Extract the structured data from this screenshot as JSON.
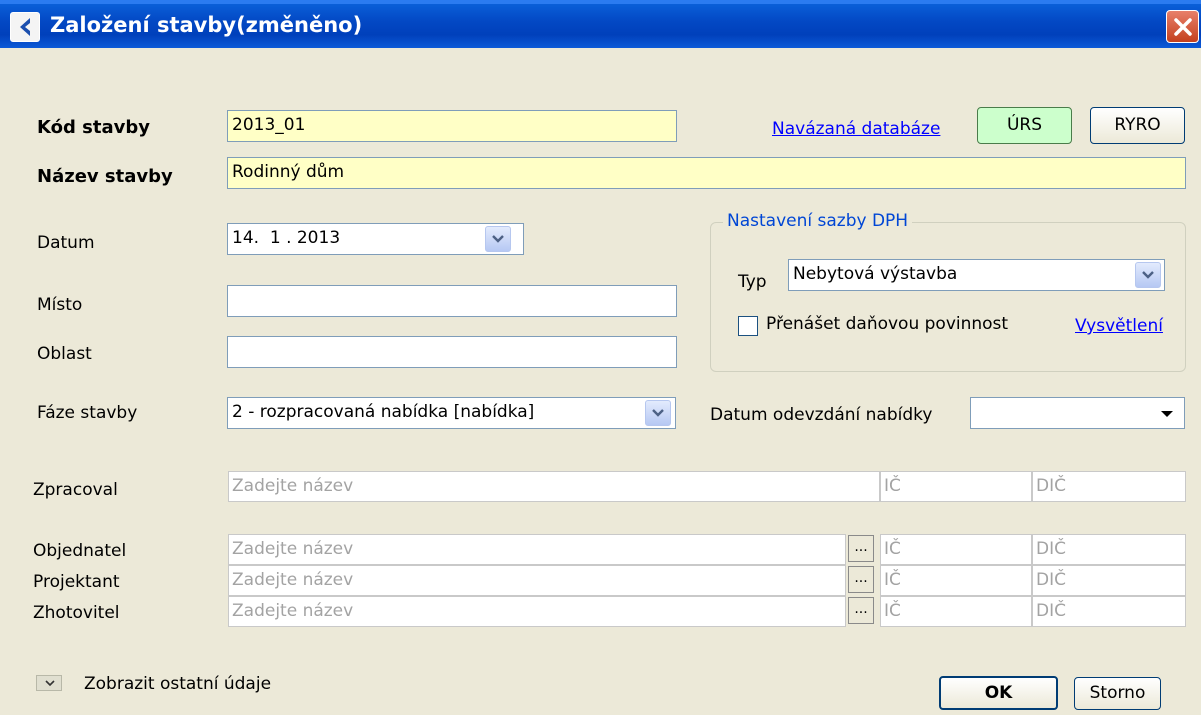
{
  "window": {
    "title": "Založení stavby(změněno)",
    "back_icon": "back-arrow-icon",
    "close_icon": "close-icon"
  },
  "header": {
    "kod_label": "Kód stavby",
    "kod_value": "2013_01",
    "nazev_label": "Název stavby",
    "nazev_value": "Rodinný dům",
    "db_link": "Navázaná databáze",
    "urs_button": "ÚRS",
    "ryro_button": "RYRO"
  },
  "fields": {
    "datum_label": "Datum",
    "datum_value": "14.  1 . 2013",
    "misto_label": "Místo",
    "misto_value": "",
    "oblast_label": "Oblast",
    "oblast_value": "",
    "faze_label": "Fáze stavby",
    "faze_value": "2 - rozpracovaná nabídka [nabídka]",
    "odevzdani_label": "Datum odevzdání nabídky",
    "odevzdani_value": ""
  },
  "dph": {
    "legend": "Nastavení sazby DPH",
    "typ_label": "Typ",
    "typ_value": "Nebytová výstavba",
    "checkbox_label": "Přenášet daňovou povinnost",
    "checkbox_checked": false,
    "link": "Vysvětlení"
  },
  "parties": {
    "placeholder_name": "Zadejte název",
    "placeholder_ic": "IČ",
    "placeholder_dic": "DIČ",
    "zpracoval_label": "Zpracoval",
    "objednatel_label": "Objednatel",
    "projektant_label": "Projektant",
    "zhotovitel_label": "Zhotovitel",
    "browse_label": "..."
  },
  "footer": {
    "toggle_label": "Zobrazit ostatní údaje",
    "ok_button": "OK",
    "storno_button": "Storno"
  },
  "colors": {
    "required_field_bg": "#ffffc6",
    "urs_button_bg": "#ccffcc",
    "link": "#0000ff",
    "group_legend": "#0046d5"
  }
}
